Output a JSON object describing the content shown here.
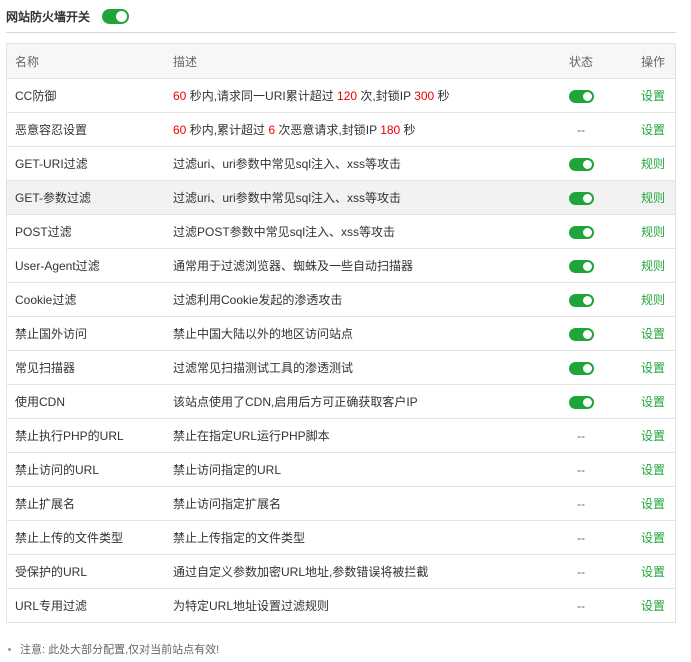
{
  "header": {
    "title": "网站防火墙开关"
  },
  "table": {
    "headers": {
      "name": "名称",
      "desc": "描述",
      "status": "状态",
      "op": "操作"
    },
    "rows": [
      {
        "name": "CC防御",
        "desc": [
          "60",
          " 秒内,请求同一URI累计超过 ",
          "120",
          " 次,封锁IP ",
          "300",
          " 秒"
        ],
        "status": "on",
        "op": "设置"
      },
      {
        "name": "恶意容忍设置",
        "desc": [
          "60",
          " 秒内,累计超过 ",
          "6",
          " 次恶意请求,封锁IP ",
          "180",
          " 秒"
        ],
        "status": "--",
        "op": "设置"
      },
      {
        "name": "GET-URI过滤",
        "desc": "过滤uri、uri参数中常见sql注入、xss等攻击",
        "status": "on",
        "op": "规则"
      },
      {
        "name": "GET-参数过滤",
        "desc": "过滤uri、uri参数中常见sql注入、xss等攻击",
        "status": "on",
        "op": "规则"
      },
      {
        "name": "POST过滤",
        "desc": "过滤POST参数中常见sql注入、xss等攻击",
        "status": "on",
        "op": "规则"
      },
      {
        "name": "User-Agent过滤",
        "desc": "通常用于过滤浏览器、蜘蛛及一些自动扫描器",
        "status": "on",
        "op": "规则"
      },
      {
        "name": "Cookie过滤",
        "desc": "过滤利用Cookie发起的渗透攻击",
        "status": "on",
        "op": "规则"
      },
      {
        "name": "禁止国外访问",
        "desc": "禁止中国大陆以外的地区访问站点",
        "status": "on",
        "op": "设置"
      },
      {
        "name": "常见扫描器",
        "desc": "过滤常见扫描测试工具的渗透测试",
        "status": "on",
        "op": "设置"
      },
      {
        "name": "使用CDN",
        "desc": "该站点使用了CDN,启用后方可正确获取客户IP",
        "status": "on",
        "op": "设置"
      },
      {
        "name": "禁止执行PHP的URL",
        "desc": "禁止在指定URL运行PHP脚本",
        "status": "--",
        "op": "设置"
      },
      {
        "name": "禁止访问的URL",
        "desc": "禁止访问指定的URL",
        "status": "--",
        "op": "设置"
      },
      {
        "name": "禁止扩展名",
        "desc": "禁止访问指定扩展名",
        "status": "--",
        "op": "设置"
      },
      {
        "name": "禁止上传的文件类型",
        "desc": "禁止上传指定的文件类型",
        "status": "--",
        "op": "设置"
      },
      {
        "name": "受保护的URL",
        "desc": "通过自定义参数加密URL地址,参数错误将被拦截",
        "status": "--",
        "op": "设置"
      },
      {
        "name": "URL专用过滤",
        "desc": "为特定URL地址设置过滤规则",
        "status": "--",
        "op": "设置"
      }
    ]
  },
  "note": "注意: 此处大部分配置,仅对当前站点有效!",
  "colors": {
    "accent": "#20a53a",
    "highlight": "#e00000"
  }
}
